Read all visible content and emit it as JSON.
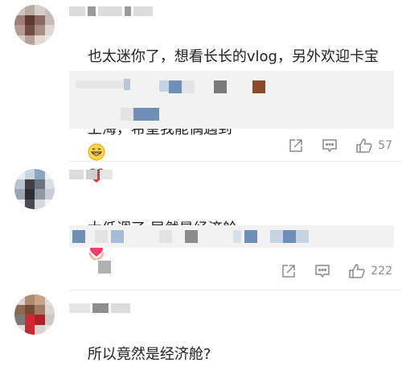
{
  "comments": [
    {
      "text_line1": "也太迷你了，想看长长的vlog，另外欢迎卡宝回",
      "text_line2": "上海，希望我能偶遇到",
      "emojis": [
        "grin-emoji",
        "red-heart-emoji"
      ],
      "likes": "57"
    },
    {
      "text": "太低调了 居然是经济舱",
      "emojis": [
        "heart-hands-emoji"
      ],
      "likes": "222"
    },
    {
      "text": "所以竟然是经济舱?"
    }
  ],
  "icons": {
    "share": "share-icon",
    "comment": "comment-icon",
    "like": "thumbs-up-icon"
  },
  "colors": {
    "accent_heart": "#e8323c",
    "action_gray": "#8a8a8a",
    "reply_bg": "#f2f2f2",
    "pixel_blue": "#5a8fc9"
  }
}
